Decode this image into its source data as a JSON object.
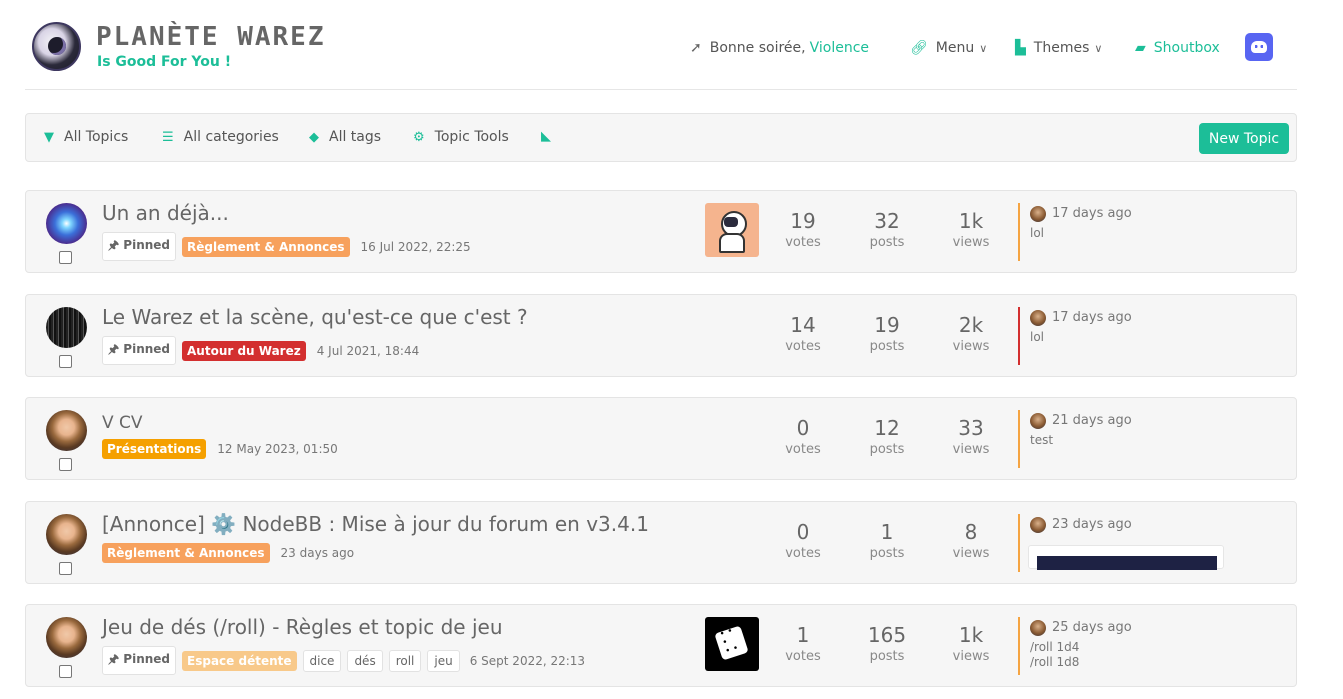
{
  "header": {
    "brand_title": "PLANÈTE WAREZ",
    "brand_subtitle": "Is Good For You !",
    "greeting": "Bonne soirée, ",
    "username": "Violence",
    "menu_label": "Menu",
    "themes_label": "Themes",
    "shoutbox_label": "Shoutbox"
  },
  "toolbar": {
    "all_topics": "All Topics",
    "all_categories": "All categories",
    "all_tags": "All tags",
    "topic_tools": "Topic Tools",
    "new_topic": "New Topic"
  },
  "colors": {
    "accent": "#1cbe98",
    "category_reglement": "#f7a15d",
    "category_warez": "#d32f2f",
    "category_presentations": "#f5a000",
    "category_detente": "#f8c98a",
    "last_post_border": "#f5a442"
  },
  "topics": [
    {
      "title": "Un an déjà...",
      "pinned_label": "Pinned",
      "category": "Règlement & Annonces",
      "date": "16 Jul 2022, 22:25",
      "votes": "19",
      "votes_label": "votes",
      "posts": "32",
      "posts_label": "posts",
      "views": "1k",
      "views_label": "views",
      "last_time": "17 days ago",
      "last_text": "lol"
    },
    {
      "title": "Le Warez et la scène, qu'est-ce que c'est ?",
      "pinned_label": "Pinned",
      "category": "Autour du Warez",
      "date": "4 Jul 2021, 18:44",
      "votes": "14",
      "votes_label": "votes",
      "posts": "19",
      "posts_label": "posts",
      "views": "2k",
      "views_label": "views",
      "last_time": "17 days ago",
      "last_text": "lol"
    },
    {
      "title": "V CV",
      "category": "Présentations",
      "date": "12 May 2023, 01:50",
      "votes": "0",
      "votes_label": "votes",
      "posts": "12",
      "posts_label": "posts",
      "views": "33",
      "views_label": "views",
      "last_time": "21 days ago",
      "last_text": "test"
    },
    {
      "title": "[Annonce] ⚙️ NodeBB : Mise à jour du forum en v3.4.1",
      "category": "Règlement & Annonces",
      "date": "23 days ago",
      "votes": "0",
      "votes_label": "votes",
      "posts": "1",
      "posts_label": "posts",
      "views": "8",
      "views_label": "views",
      "last_time": "23 days ago"
    },
    {
      "title": "Jeu de dés (/roll) - Règles et topic de jeu",
      "pinned_label": "Pinned",
      "category": "Espace détente",
      "tags": [
        "dice",
        "dés",
        "roll",
        "jeu"
      ],
      "date": "6 Sept 2022, 22:13",
      "votes": "1",
      "votes_label": "votes",
      "posts": "165",
      "posts_label": "posts",
      "views": "1k",
      "views_label": "views",
      "last_time": "25 days ago",
      "last_text_1": "/roll 1d4",
      "last_text_2": "/roll 1d8"
    }
  ]
}
